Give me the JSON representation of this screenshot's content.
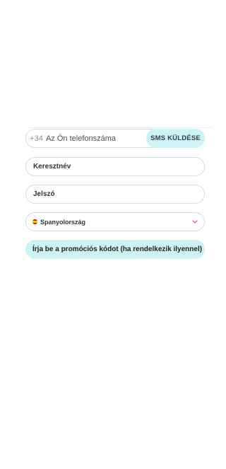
{
  "form": {
    "phone": {
      "prefix": "+34",
      "placeholder": "Az Ön telefonszáma",
      "sms_button_label": "SMS KÜLDÉSE"
    },
    "first_name": {
      "placeholder": "Keresztnév"
    },
    "password": {
      "placeholder": "Jelszó"
    },
    "country": {
      "selected": "Spanyolország",
      "flag_icon": "spain-flag-icon",
      "chevron_icon": "chevron-down-icon"
    },
    "promo": {
      "label": "Írja be a promóciós kódot (ha rendelkezik ilyennel)"
    }
  },
  "colors": {
    "accent": "#cdf3f6",
    "chevron": "#e0556a",
    "border": "#d6dbe0"
  }
}
